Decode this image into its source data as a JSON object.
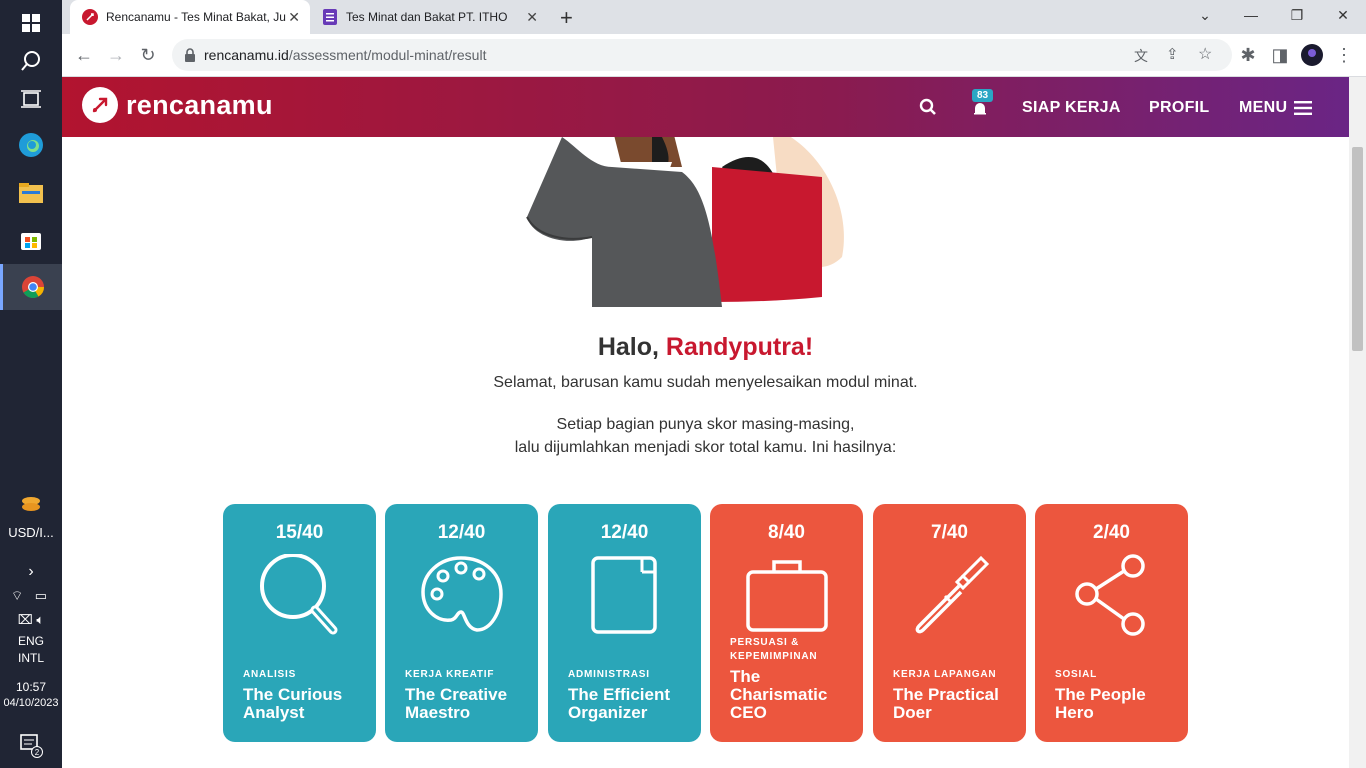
{
  "taskbar": {
    "currency": "USD/I...",
    "lang1": "ENG",
    "lang2": "INTL",
    "time": "10:57",
    "date": "04/10/2023",
    "notifications": "2"
  },
  "browser": {
    "tabs": [
      {
        "title": "Rencanamu - Tes Minat Bakat, Ju"
      },
      {
        "title": "Tes Minat dan Bakat PT. ITHO"
      }
    ],
    "url_host": "rencanamu.id",
    "url_path": "/assessment/modul-minat/result"
  },
  "header": {
    "brand": "rencanamu",
    "badge": "83",
    "nav": [
      "SIAP KERJA",
      "PROFIL",
      "MENU"
    ]
  },
  "result": {
    "greeting": "Halo, ",
    "name": "Randyputra!",
    "line1": "Selamat, barusan kamu sudah menyelesaikan modul minat.",
    "line2": "Setiap bagian punya skor masing-masing,",
    "line3": "lalu dijumlahkan menjadi skor total kamu. Ini hasilnya:"
  },
  "cards": [
    {
      "score": "15/40",
      "category": "ANALISIS",
      "title": "The Curious Analyst",
      "icon": "magnifier-icon",
      "color": "#2aa6b8"
    },
    {
      "score": "12/40",
      "category": "KERJA KREATIF",
      "title": "The Creative Maestro",
      "icon": "palette-icon",
      "color": "#2aa6b8"
    },
    {
      "score": "12/40",
      "category": "ADMINISTRASI",
      "title": "The Efficient Organizer",
      "icon": "folder-icon",
      "color": "#2aa6b8"
    },
    {
      "score": "8/40",
      "category": "PERSUASI & KEPEMIMPINAN",
      "title": "The Charismatic CEO",
      "icon": "briefcase-icon",
      "color": "#ec563e"
    },
    {
      "score": "7/40",
      "category": "KERJA LAPANGAN",
      "title": "The Practical Doer",
      "icon": "screwdriver-icon",
      "color": "#ec563e"
    },
    {
      "score": "2/40",
      "category": "SOSIAL",
      "title": "The People Hero",
      "icon": "share-icon",
      "color": "#ec563e"
    }
  ]
}
